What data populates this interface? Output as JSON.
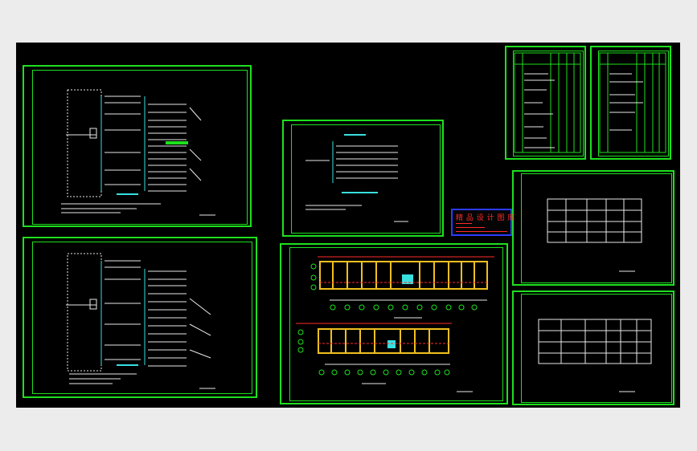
{
  "watermark": {
    "title": "精 品 设 计 图 库"
  },
  "colors": {
    "background": "#ececec",
    "canvas": "#000000",
    "frame": "#1ee01e",
    "line_white": "#e8e8e8",
    "line_cyan": "#38e0e0",
    "line_yellow": "#f0c020",
    "line_red": "#ff2a2a",
    "stamp_border": "#2a3cff"
  },
  "sheets": [
    {
      "name": "distribution-diagram-1",
      "type": "schematic"
    },
    {
      "name": "distribution-diagram-2",
      "type": "schematic"
    },
    {
      "name": "system-diagram",
      "type": "schematic"
    },
    {
      "name": "floor-plan",
      "type": "plan"
    },
    {
      "name": "materials-table-1",
      "type": "table"
    },
    {
      "name": "materials-table-2",
      "type": "table"
    },
    {
      "name": "schedule-table-1",
      "type": "table"
    },
    {
      "name": "schedule-table-2",
      "type": "table"
    }
  ]
}
